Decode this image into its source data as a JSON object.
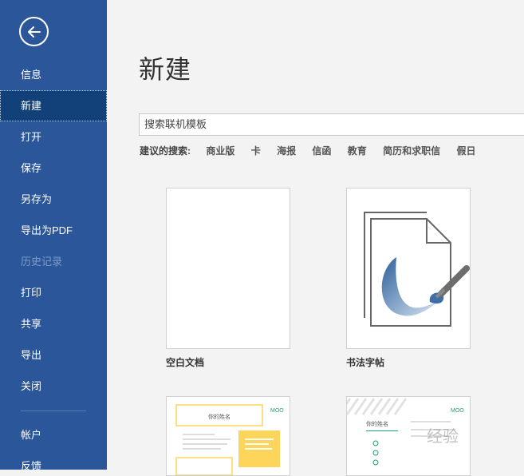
{
  "sidebar": {
    "back_icon": "arrow-left-icon",
    "items": [
      {
        "label": "信息",
        "state": "normal"
      },
      {
        "label": "新建",
        "state": "active"
      },
      {
        "label": "打开",
        "state": "normal"
      },
      {
        "label": "保存",
        "state": "normal"
      },
      {
        "label": "另存为",
        "state": "normal"
      },
      {
        "label": "导出为PDF",
        "state": "normal"
      },
      {
        "label": "历史记录",
        "state": "disabled"
      },
      {
        "label": "打印",
        "state": "normal"
      },
      {
        "label": "共享",
        "state": "normal"
      },
      {
        "label": "导出",
        "state": "normal"
      },
      {
        "label": "关闭",
        "state": "normal"
      }
    ],
    "bottom_items": [
      {
        "label": "帐户"
      },
      {
        "label": "反馈"
      }
    ]
  },
  "main": {
    "title": "新建",
    "search": {
      "placeholder": "搜索联机模板"
    },
    "suggested_label": "建议的搜索:",
    "suggested": [
      "商业版",
      "卡",
      "海报",
      "信函",
      "教育",
      "简历和求职信",
      "假日"
    ],
    "templates": [
      {
        "label": "空白文档"
      },
      {
        "label": "书法字帖"
      },
      {
        "label": "",
        "heading": "你的姓名",
        "brand": "MOO"
      },
      {
        "label": "",
        "heading": "你的姓名",
        "brand": "MOO",
        "watermark": "经验"
      }
    ]
  },
  "colors": {
    "sidebar_bg": "#2b579a",
    "sidebar_active": "#124078",
    "accent_yellow": "#fdd55a",
    "moo_green": "#1e9e73",
    "brush_blue": "#3e6fa8"
  }
}
